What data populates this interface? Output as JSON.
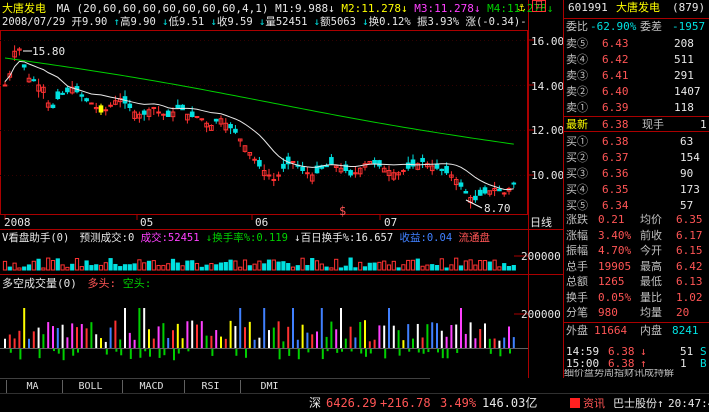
{
  "header": {
    "name": "大唐发电",
    "ma_label": "MA (20,60,60,60,60,60,60,60,4,1)",
    "m1": "M1:9.988",
    "m2": "M2:11.278",
    "m3": "M3:11.278",
    "m4": "M4:11.278",
    "row2": {
      "date": "2008/07/29",
      "open": "开9.90",
      "high": "高9.90",
      "low": "低9.51",
      "close": "收9.59",
      "volume": "量52451",
      "amount": "额5063",
      "turnover": "换0.12%",
      "amplitude": "振3.93%",
      "change": "涨(-0.34)-"
    },
    "icons": [
      "arrow-down-icon",
      "arrow-up-icon",
      "page-icon"
    ]
  },
  "price_axis": [
    "16.00",
    "14.00",
    "12.00",
    "10.00"
  ],
  "price_annotations": {
    "high_label": "15.80",
    "low_label": "8.70",
    "marker": "$"
  },
  "time_axis": {
    "labels": [
      "2008",
      "05",
      "06",
      "07"
    ],
    "right": "日线"
  },
  "indicator1": {
    "title": "V看盘助手(0)",
    "pred": "预测成交:0",
    "vol": "成交:52451",
    "turnover": "换手率%:0.119",
    "hundred": "百日换手%:16.657",
    "income": "收益:0.04",
    "flow": "流通盘",
    "axis": "200000"
  },
  "indicator2": {
    "title": "多空成交量(0)",
    "long": "多头:",
    "short": "空头:",
    "axis": "200000"
  },
  "tabs": [
    "MA",
    "BOLL",
    "MACD",
    "RSI",
    "DMI"
  ],
  "status": {
    "market": "深",
    "index": "6426.29",
    "change": "+216.78",
    "pct": "3.49%",
    "amount": "146.03亿",
    "news": "资讯",
    "ticker": "巴士股份↑",
    "time": "20:47:41"
  },
  "side": {
    "code": "601991",
    "name": "大唐发电",
    "num": "(879)",
    "weibi_label": "委比",
    "weibi": "-62.90%",
    "weicha_label": "委差",
    "weicha": "-1957",
    "asks": [
      {
        "label": "卖⑤",
        "price": "6.43",
        "vol": "208"
      },
      {
        "label": "卖④",
        "price": "6.42",
        "vol": "511"
      },
      {
        "label": "卖③",
        "price": "6.41",
        "vol": "291"
      },
      {
        "label": "卖②",
        "price": "6.40",
        "vol": "1407"
      },
      {
        "label": "卖①",
        "price": "6.39",
        "vol": "118"
      }
    ],
    "last_label": "最新",
    "last": "6.38",
    "cur_label": "现手",
    "cur": "1",
    "bids": [
      {
        "label": "买①",
        "price": "6.38",
        "vol": "63"
      },
      {
        "label": "买②",
        "price": "6.37",
        "vol": "154"
      },
      {
        "label": "买③",
        "price": "6.36",
        "vol": "90"
      },
      {
        "label": "买④",
        "price": "6.35",
        "vol": "173"
      },
      {
        "label": "买⑤",
        "price": "6.34",
        "vol": "57"
      }
    ],
    "stats": [
      {
        "l1": "涨跌",
        "v1": "0.21",
        "l2": "均价",
        "v2": "6.35"
      },
      {
        "l1": "涨幅",
        "v1": "3.40%",
        "l2": "前收",
        "v2": "6.17"
      },
      {
        "l1": "振幅",
        "v1": "4.70%",
        "l2": "今开",
        "v2": "6.15"
      },
      {
        "l1": "总手",
        "v1": "19905",
        "l2": "最高",
        "v2": "6.42"
      },
      {
        "l1": "总额",
        "v1": "1265",
        "l2": "最低",
        "v2": "6.13"
      },
      {
        "l1": "换手",
        "v1": "0.05%",
        "l2": "量比",
        "v2": "1.02"
      },
      {
        "l1": "分笔",
        "v1": "980",
        "l2": "均量",
        "v2": "20"
      }
    ],
    "outer_label": "外盘",
    "outer": "11664",
    "inner_label": "内盘",
    "inner": "8241",
    "ticks": [
      {
        "time": "14:59",
        "price": "6.38",
        "dir": "↓",
        "vol": "51",
        "flag": "S"
      },
      {
        "time": "15:00",
        "price": "6.38",
        "dir": "↑",
        "vol": "1",
        "flag": "B"
      }
    ],
    "footer": "细价盘势周指财讯成持解"
  },
  "colors": {
    "up": "#ff3232",
    "down": "#00e0e0",
    "ma20": "#e8e8e8",
    "ma60": "#00d000",
    "doji": "#ffff00"
  }
}
